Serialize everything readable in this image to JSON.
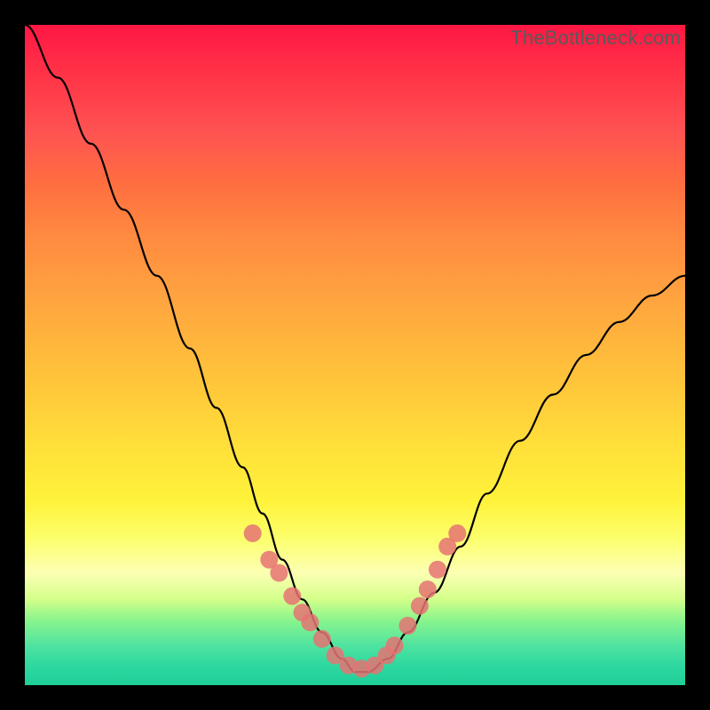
{
  "watermark": "TheBottleneck.com",
  "chart_data": {
    "type": "line",
    "title": "",
    "xlabel": "",
    "ylabel": "",
    "x_range": [
      0,
      1
    ],
    "y_range": [
      0,
      1
    ],
    "series": [
      {
        "name": "bottleneck-curve",
        "x": [
          0.0,
          0.05,
          0.1,
          0.15,
          0.2,
          0.25,
          0.29,
          0.33,
          0.36,
          0.39,
          0.42,
          0.45,
          0.48,
          0.5,
          0.52,
          0.55,
          0.58,
          0.62,
          0.66,
          0.7,
          0.75,
          0.8,
          0.85,
          0.9,
          0.95,
          1.0
        ],
        "y": [
          1.0,
          0.92,
          0.82,
          0.72,
          0.62,
          0.51,
          0.42,
          0.33,
          0.26,
          0.19,
          0.13,
          0.08,
          0.04,
          0.02,
          0.02,
          0.04,
          0.08,
          0.14,
          0.21,
          0.29,
          0.37,
          0.44,
          0.5,
          0.55,
          0.59,
          0.62
        ]
      }
    ],
    "markers": {
      "name": "highlighted-points",
      "x": [
        0.345,
        0.37,
        0.385,
        0.405,
        0.42,
        0.432,
        0.45,
        0.47,
        0.49,
        0.51,
        0.53,
        0.548,
        0.56,
        0.58,
        0.598,
        0.61,
        0.625,
        0.64,
        0.655
      ],
      "y": [
        0.23,
        0.19,
        0.17,
        0.135,
        0.11,
        0.095,
        0.07,
        0.045,
        0.03,
        0.025,
        0.03,
        0.045,
        0.06,
        0.09,
        0.12,
        0.145,
        0.175,
        0.21,
        0.23
      ]
    },
    "marker_radius": 10,
    "curve_stroke": "#000000",
    "marker_fill": "#e57373",
    "background_gradient": [
      "#ff1744",
      "#ffca3a",
      "#1ecf98"
    ]
  }
}
